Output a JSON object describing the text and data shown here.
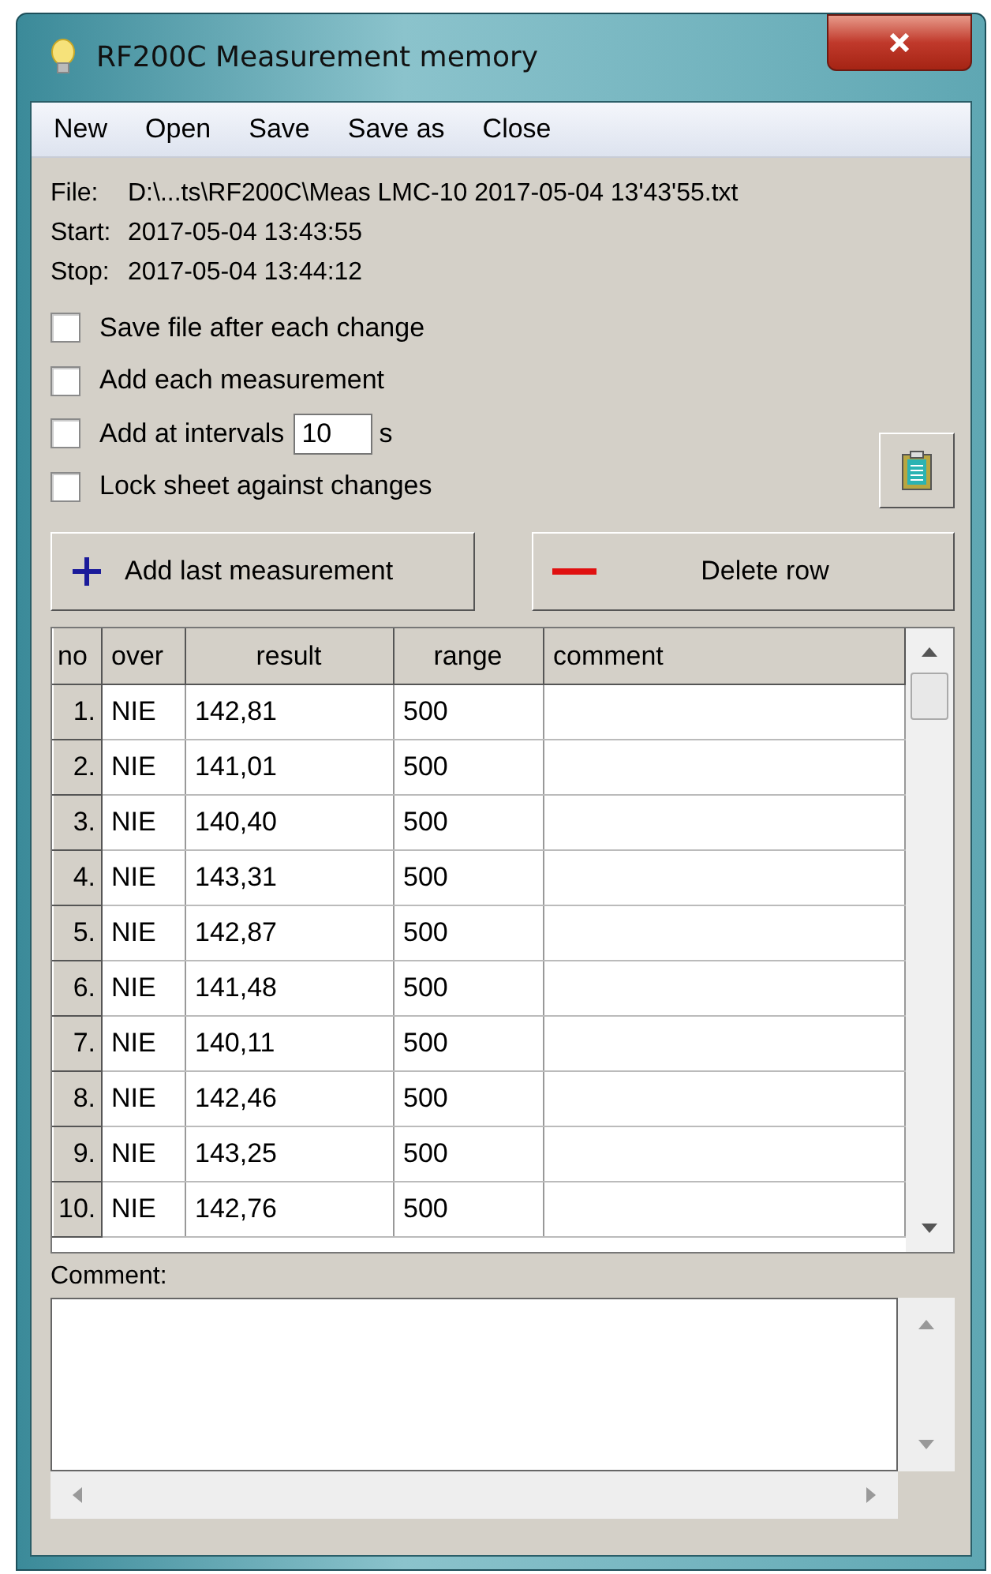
{
  "window": {
    "title": "RF200C Measurement memory"
  },
  "menu": [
    "New",
    "Open",
    "Save",
    "Save as",
    "Close"
  ],
  "info": [
    {
      "label": "File:",
      "value": "D:\\...ts\\RF200C\\Meas LMC-10 2017-05-04 13'43'55.txt"
    },
    {
      "label": "Start:",
      "value": "2017-05-04 13:43:55"
    },
    {
      "label": "Stop:",
      "value": "2017-05-04 13:44:12"
    }
  ],
  "options": [
    {
      "kind": "check",
      "label": "Save file after each change",
      "checked": false
    },
    {
      "kind": "check",
      "label": "Add each measurement",
      "checked": false
    },
    {
      "kind": "interval",
      "label": "Add at intervals",
      "checked": false,
      "value": "10",
      "unit": "s"
    },
    {
      "kind": "check",
      "label": "Lock sheet against changes",
      "checked": false
    }
  ],
  "buttons": [
    {
      "kind": "add",
      "label": "Add last measurement"
    },
    {
      "kind": "delete",
      "label": "Delete row"
    }
  ],
  "table": {
    "columns": [
      "no",
      "over",
      "result",
      "range",
      "comment"
    ],
    "rows": [
      [
        "1.",
        "NIE",
        "142,81",
        "500",
        ""
      ],
      [
        "2.",
        "NIE",
        "141,01",
        "500",
        ""
      ],
      [
        "3.",
        "NIE",
        "140,40",
        "500",
        ""
      ],
      [
        "4.",
        "NIE",
        "143,31",
        "500",
        ""
      ],
      [
        "5.",
        "NIE",
        "142,87",
        "500",
        ""
      ],
      [
        "6.",
        "NIE",
        "141,48",
        "500",
        ""
      ],
      [
        "7.",
        "NIE",
        "140,11",
        "500",
        ""
      ],
      [
        "8.",
        "NIE",
        "142,46",
        "500",
        ""
      ],
      [
        "9.",
        "NIE",
        "143,25",
        "500",
        ""
      ],
      [
        "10.",
        "NIE",
        "142,76",
        "500",
        ""
      ]
    ]
  },
  "comment": {
    "label": "Comment:"
  }
}
